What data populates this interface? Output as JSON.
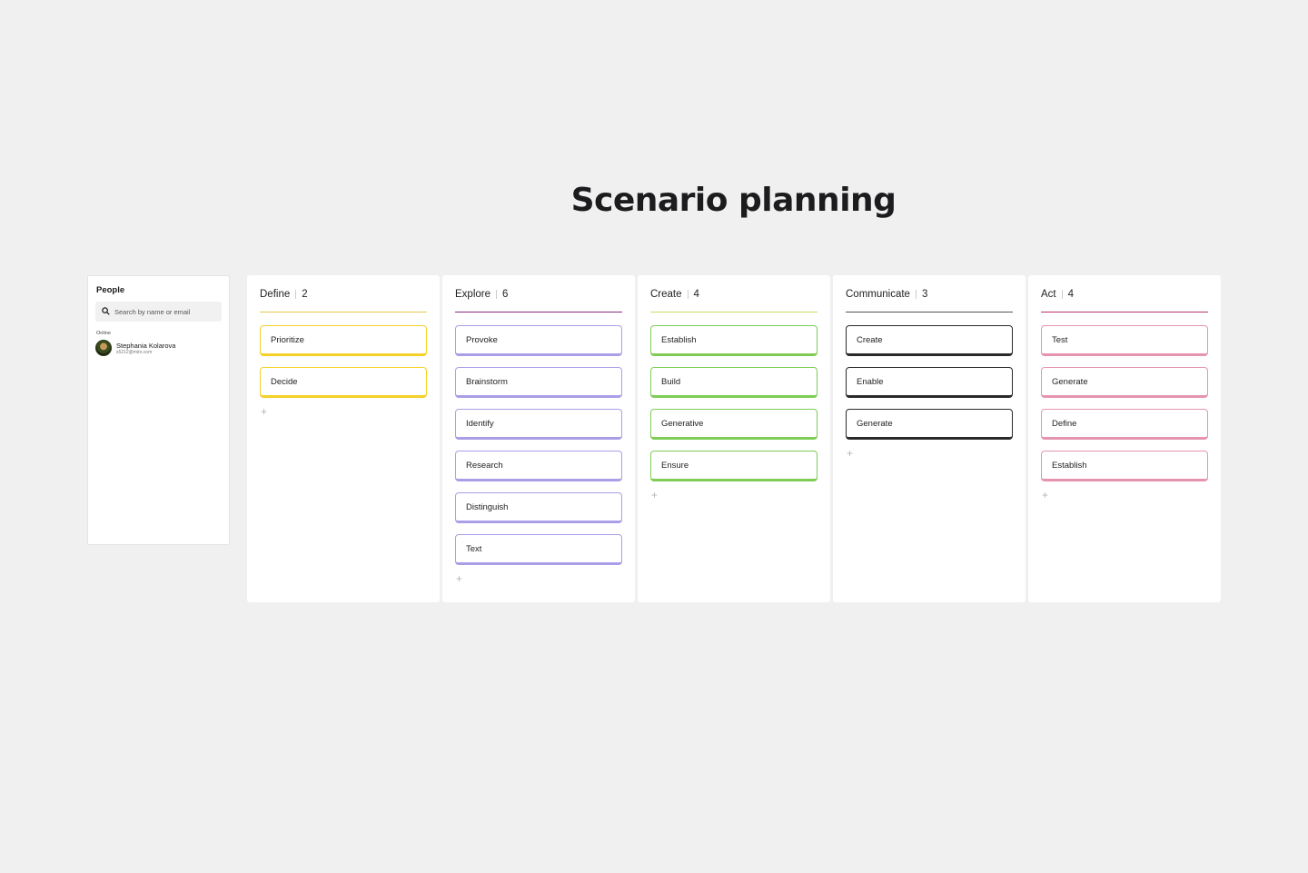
{
  "board": {
    "title": "Scenario planning"
  },
  "people_panel": {
    "title": "People",
    "search_placeholder": "Search by name or email",
    "online_label": "Online",
    "users": [
      {
        "name": "Stephania Kolarova",
        "email": "s5212@miro.com"
      }
    ]
  },
  "columns": [
    {
      "title": "Define",
      "count": "2",
      "color": "#f5d128",
      "cards": [
        "Prioritize",
        "Decide"
      ]
    },
    {
      "title": "Explore",
      "count": "6",
      "color": "#ab9ee8",
      "cards": [
        "Provoke",
        "Brainstorm",
        "Identify",
        "Research",
        "Distinguish",
        "Text"
      ]
    },
    {
      "title": "Create",
      "count": "4",
      "color": "#7fcc55",
      "cards": [
        "Establish",
        "Build",
        "Generative",
        "Ensure"
      ]
    },
    {
      "title": "Communicate",
      "count": "3",
      "color": "#2a2a2a",
      "cards": [
        "Create",
        "Enable",
        "Generate"
      ]
    },
    {
      "title": "Act",
      "count": "4",
      "color": "#e594b0",
      "cards": [
        "Test",
        "Generate",
        "Define",
        "Establish"
      ]
    }
  ],
  "column_line_colors": [
    "#e8c74c",
    "#8c2a7d",
    "#cfd86a",
    "#555555",
    "#b8326f"
  ],
  "add_card_label": "+"
}
